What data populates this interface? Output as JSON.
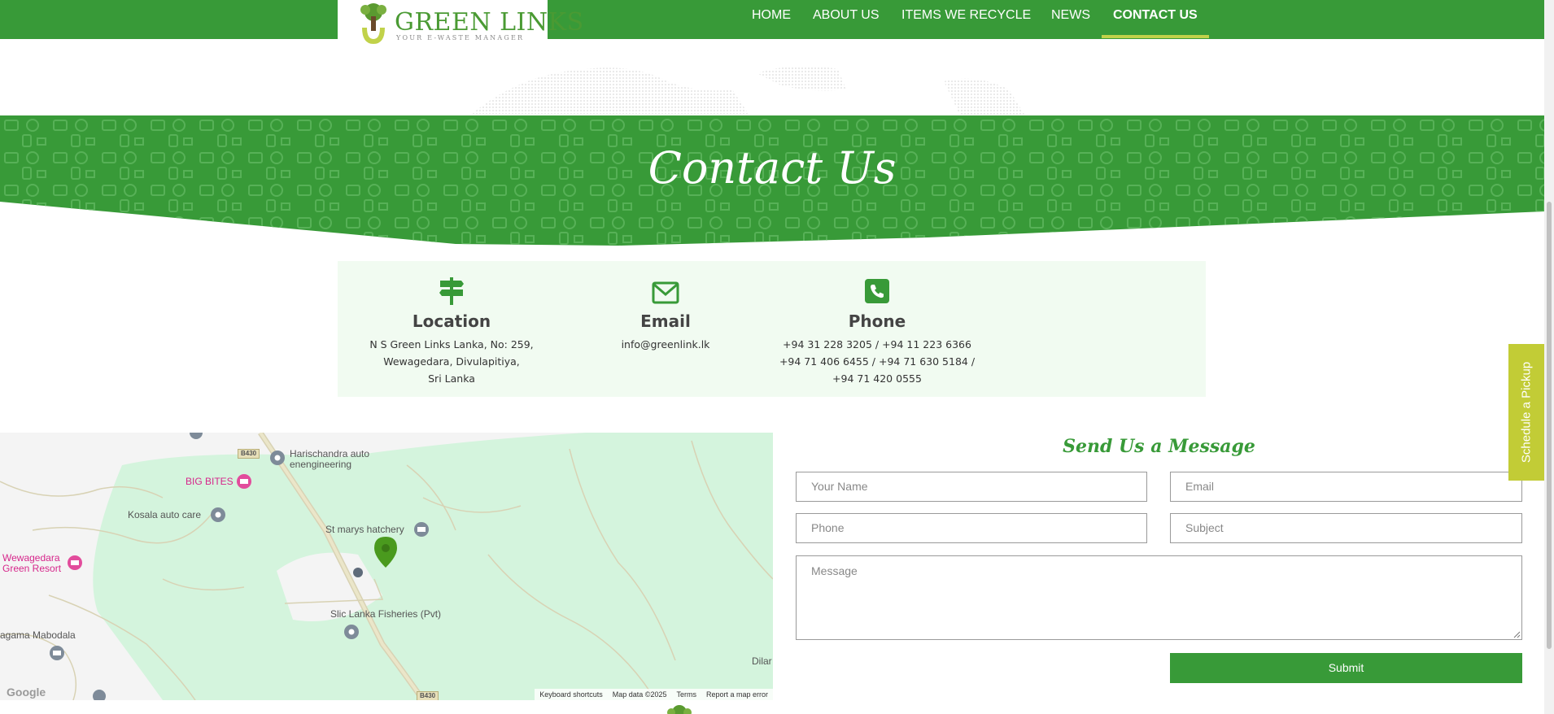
{
  "brand": {
    "title": "GREEN LINKS",
    "subtitle": "YOUR E-WASTE MANAGER"
  },
  "nav": {
    "items": [
      "HOME",
      "ABOUT US",
      "ITEMS WE RECYCLE",
      "NEWS",
      "CONTACT US"
    ],
    "active": "CONTACT US"
  },
  "banner": {
    "title": "Contact Us"
  },
  "contact": {
    "location": {
      "title": "Location",
      "lines": [
        "N S Green Links Lanka, No: 259,",
        "Wewagedara, Divulapitiya,",
        "Sri Lanka"
      ]
    },
    "email": {
      "title": "Email",
      "lines": [
        "info@greenlink.lk"
      ]
    },
    "phone": {
      "title": "Phone",
      "lines": [
        "+94 31 228 3205 / +94 11 223 6366",
        "+94 71 406 6455 / +94 71 630 5184 /",
        "+94 71 420 0555"
      ]
    }
  },
  "map": {
    "labels": {
      "harischandra": "Harischandra auto enengineering",
      "bigbites": "BIG BITES",
      "kosala": "Kosala auto care",
      "stmarys": "St marys hatchery",
      "wewagedara": "Wewagedara Green Resort",
      "slic": "Slic Lanka Fisheries (Pvt)",
      "mabodala": "agama Mabodala",
      "dilan": "Dilar"
    },
    "roads": [
      "B430",
      "B430"
    ],
    "google": "Google",
    "footer": [
      "Keyboard shortcuts",
      "Map data ©2025",
      "Terms",
      "Report a map error"
    ]
  },
  "form": {
    "title": "Send Us a Message",
    "placeholders": {
      "name": "Your Name",
      "email": "Email",
      "phone": "Phone",
      "subject": "Subject",
      "message": "Message"
    },
    "submit": "Submit"
  },
  "side_tab": {
    "label": "Schedule a Pickup"
  },
  "colors": {
    "primary": "#389a38",
    "accent": "#c2cc36",
    "panel": "#f1fbf1"
  }
}
